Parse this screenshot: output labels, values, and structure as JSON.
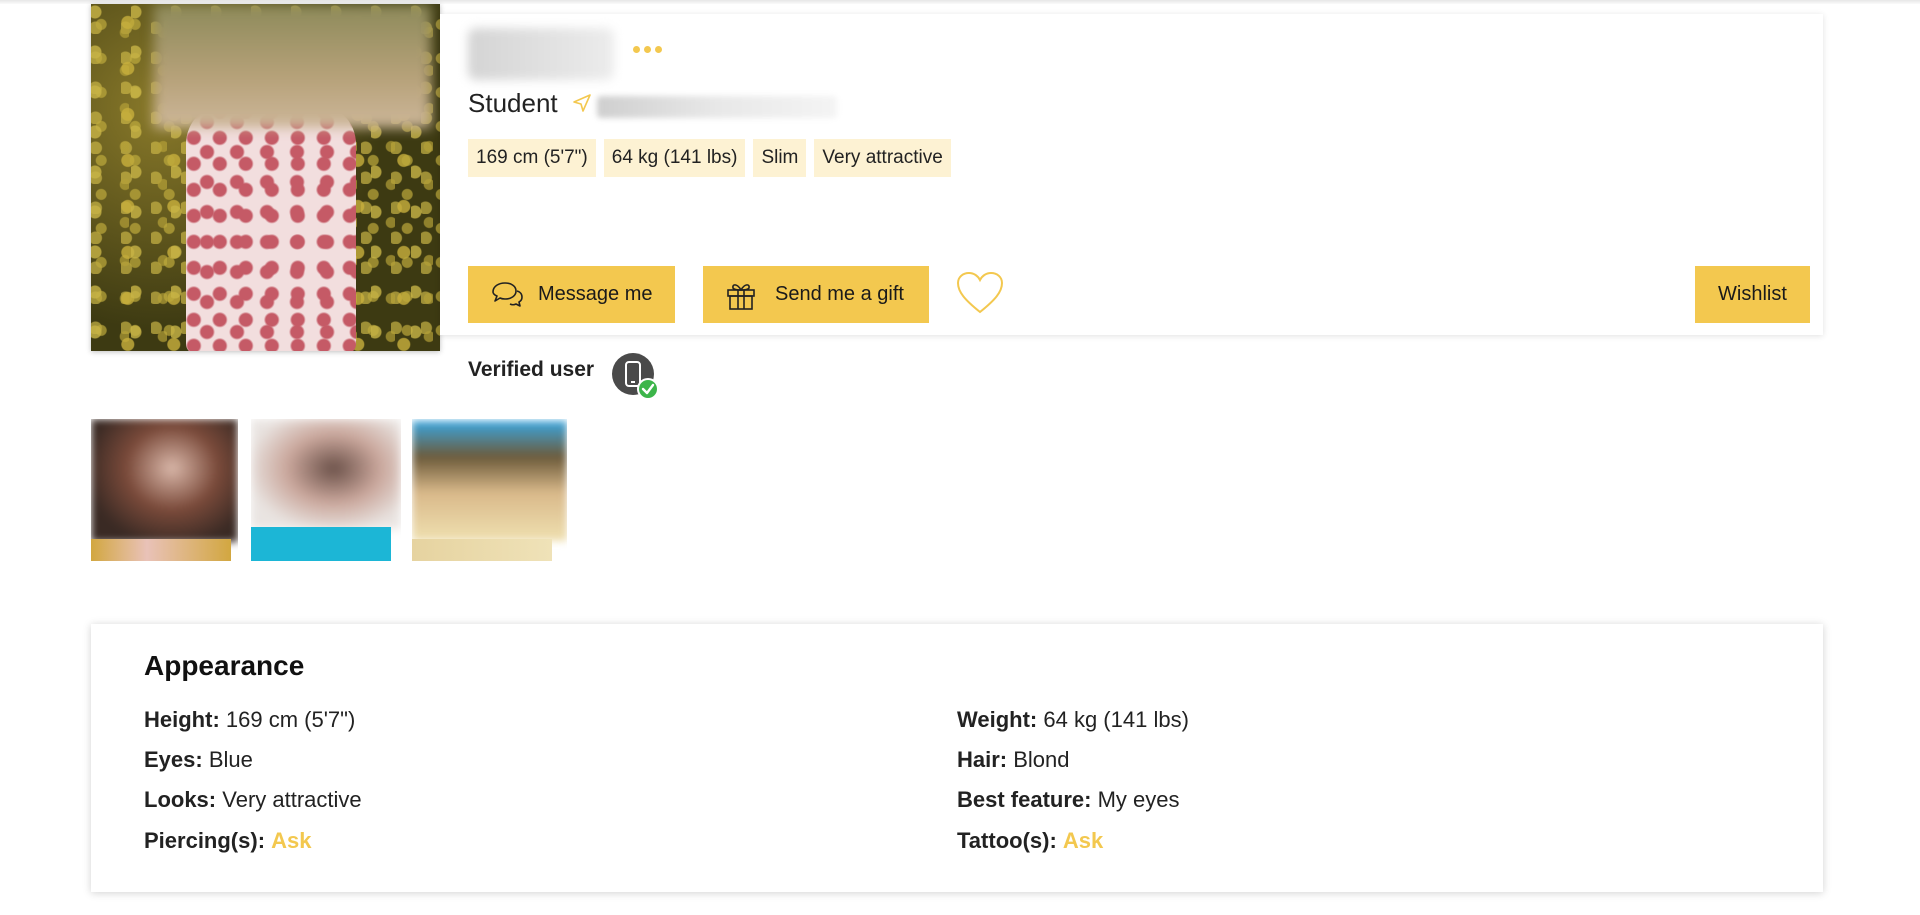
{
  "profile": {
    "occupation": "Student",
    "tags": [
      "169 cm (5'7\")",
      "64 kg (141 lbs)",
      "Slim",
      "Very attractive"
    ]
  },
  "actions": {
    "message_label": "Message me",
    "gift_label": "Send me a gift",
    "wishlist_label": "Wishlist"
  },
  "verification": {
    "label": "Verified user"
  },
  "appearance": {
    "title": "Appearance",
    "height_label": "Height:",
    "height_value": "169 cm (5'7\")",
    "weight_label": "Weight:",
    "weight_value": "64 kg (141 lbs)",
    "eyes_label": "Eyes:",
    "eyes_value": "Blue",
    "hair_label": "Hair:",
    "hair_value": "Blond",
    "looks_label": "Looks:",
    "looks_value": "Very attractive",
    "best_feature_label": "Best feature:",
    "best_feature_value": "My eyes",
    "piercings_label": "Piercing(s):",
    "piercings_value": "Ask",
    "tattoos_label": "Tattoo(s):",
    "tattoos_value": "Ask"
  },
  "icons": {
    "options": "more-dots-icon",
    "location": "location-arrow-icon",
    "message": "chat-bubbles-icon",
    "gift": "gift-icon",
    "favorite": "heart-icon",
    "verified": "verified-phone-icon"
  },
  "colors": {
    "accent": "#f3c84f",
    "tag_bg": "#fdf2d3",
    "verified_check": "#3cb54a"
  }
}
